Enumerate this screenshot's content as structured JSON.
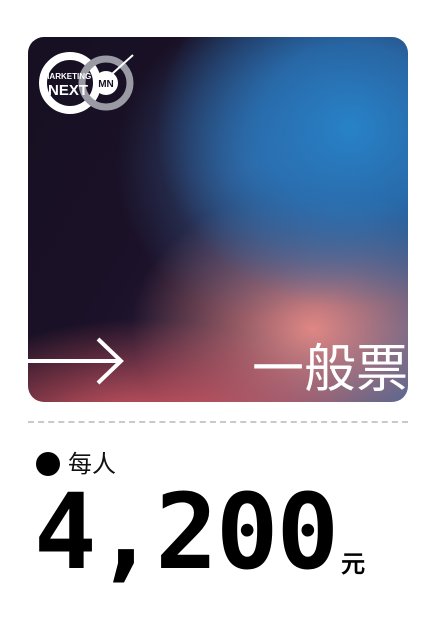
{
  "ticket": {
    "logo": {
      "line1": "MARKETING",
      "line2": "NEXT",
      "badge": "MN"
    },
    "name": "一般票",
    "per_person_label": "每人",
    "price": "4,200",
    "price_unit": "元"
  },
  "colors": {
    "accent_pink": "#ec6a6a",
    "accent_blue": "#2a7fc0",
    "dark": "#161021"
  }
}
